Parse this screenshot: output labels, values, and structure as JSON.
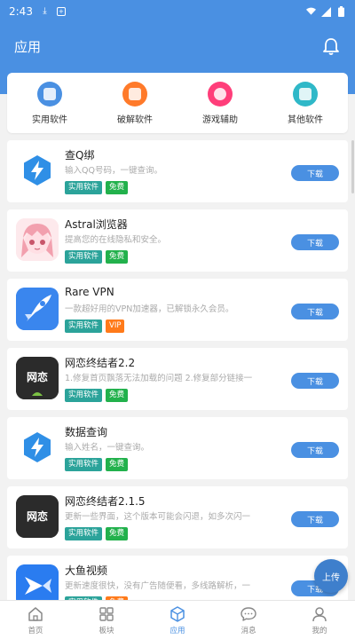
{
  "status": {
    "time": "2:43"
  },
  "header": {
    "title": "应用"
  },
  "categories": [
    {
      "label": "实用软件",
      "color": "#4a90e2"
    },
    {
      "label": "破解软件",
      "color": "#ff7a2a"
    },
    {
      "label": "游戏辅助",
      "color": "#ff3e7a"
    },
    {
      "label": "其他软件",
      "color": "#2fb8c8"
    }
  ],
  "apps": [
    {
      "name": "查Q绑",
      "desc": "输入QQ号码，一键查询。",
      "tags": [
        "实用软件",
        "免费"
      ],
      "download": "下载"
    },
    {
      "name": "Astral浏览器",
      "desc": "提高您的在线隐私和安全。",
      "tags": [
        "实用软件",
        "免费"
      ],
      "download": "下载"
    },
    {
      "name": "Rare VPN",
      "desc": "一款超好用的VPN加速器，已解锁永久会员。",
      "tags": [
        "实用软件",
        "VIP"
      ],
      "download": "下载"
    },
    {
      "name": "网恋终结者2.2",
      "desc": "1.修复首页飘落无法加载的问题 2.修复部分链接一",
      "tags": [
        "实用软件",
        "免费"
      ],
      "download": "下载",
      "icon_text": "网恋"
    },
    {
      "name": "数据查询",
      "desc": "输入姓名，一键查询。",
      "tags": [
        "实用软件",
        "免费"
      ],
      "download": "下载"
    },
    {
      "name": "网恋终结者2.1.5",
      "desc": "更新一些界面，这个版本可能会闪退，如多次闪一",
      "tags": [
        "实用软件",
        "免费"
      ],
      "download": "下载",
      "icon_text": "网恋"
    },
    {
      "name": "大鱼视频",
      "desc": "更新速度很快，没有广告随便看，多线路解析，一",
      "tags": [
        "实用软件",
        "免费"
      ],
      "download": "下载"
    }
  ],
  "fab": {
    "label": "上传"
  },
  "nav": [
    {
      "label": "首页"
    },
    {
      "label": "板块"
    },
    {
      "label": "应用"
    },
    {
      "label": "消息"
    },
    {
      "label": "我的"
    }
  ]
}
